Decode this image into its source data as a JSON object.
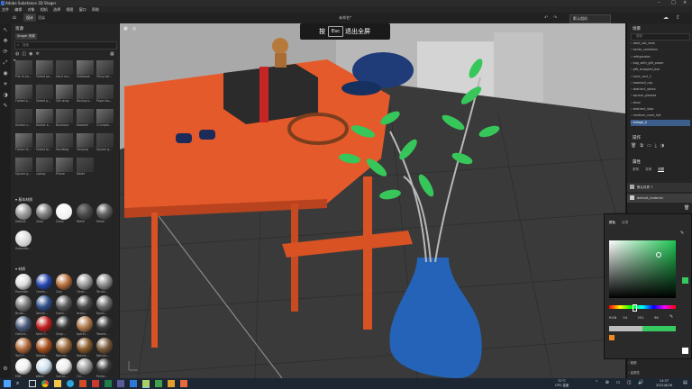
{
  "window": {
    "title": "Adobe Substance 3D Stager",
    "doc_title": "未命名*"
  },
  "menu": [
    "文件",
    "编辑",
    "对象",
    "相机",
    "选择",
    "视图",
    "窗口",
    "帮助"
  ],
  "toolbar": {
    "left_tab": "设计",
    "right_tab": "渲染",
    "camera_label": "默认相机"
  },
  "esc_banner": {
    "prefix": "按",
    "key": "Esc",
    "suffix": "退出全屏"
  },
  "assets": {
    "title": "资源",
    "tab": "Stager 资源",
    "search_placeholder": "搜索",
    "models_row1": [
      "Pile of pa...",
      "Folded pa...",
      "Hard cov...",
      "Notebook",
      "Filing bal..."
    ],
    "models_row2": [
      "Folded p...",
      "Folded p...",
      "Gift wrap",
      "Moving b...",
      "Paper ba..."
    ],
    "models_row3": [
      "Aviator s...",
      "Aviator s...",
      "Bandana",
      "Baseball",
      "Crumple..."
    ],
    "models_row4": [
      "Folded bl...",
      "Folded bl...",
      "Handbag",
      "Hanging",
      "Square g..."
    ],
    "models_row5": [
      "Square g...",
      "Laptop",
      "Phone",
      "Tablet"
    ],
    "basic_title": "基本材质",
    "basic": [
      "Default",
      "Glass",
      "Gloss",
      "Matte",
      "Metal",
      "Subsurfa..."
    ],
    "mat_title": "材质",
    "materials": [
      [
        "Porcelain",
        "Ceram...",
        "Clay",
        "Clean...",
        "Terraz..."
      ],
      [
        "Brush...",
        "Denim...",
        "Foam...",
        "Jersey...",
        "Nylon..."
      ],
      [
        "Oxford...",
        "Satin T...",
        "Singl...",
        "Sparkl...",
        "Tweed..."
      ],
      [
        "Twill f...",
        "Natura...",
        "Natura...",
        "Natura...",
        "Natura..."
      ],
      [
        "Milk",
        "Water",
        "Carrar...",
        "Chi...",
        "Portor..."
      ]
    ]
  },
  "scene_panel": {
    "title": "场景",
    "search_placeholder": "搜索",
    "items": [
      "desk_set_vase",
      "bento_zombiess",
      "refrigerator",
      "bag_with_gift_paper",
      "gift_wrapped_box",
      "tunic_cart_1",
      "baseball_cap",
      "abstract_aptsa",
      "square_glasses",
      "stool",
      "abstract_stop",
      "medium_cone_hot",
      "foliage_4"
    ]
  },
  "actions_title": "操作",
  "properties": {
    "title": "属性",
    "tabs": [
      "常规",
      "变换",
      "材质"
    ],
    "mat1": "默认材质 7",
    "mat2": "default_material"
  },
  "color_picker": {
    "tabs": [
      "颜色",
      "纹理"
    ],
    "mode": "RGB",
    "r": "54",
    "g": "201",
    "b": "96",
    "section1": "表面颜色",
    "section2": "粗糙",
    "section3": "金属性"
  },
  "taskbar": {
    "weather": "31°C",
    "weather_sub": "CPU 温度",
    "time": "14:37",
    "date": "2021/8/26"
  },
  "colors": {
    "accent": "#36c960",
    "table": "#e0562a",
    "vase": "#2463b8"
  }
}
